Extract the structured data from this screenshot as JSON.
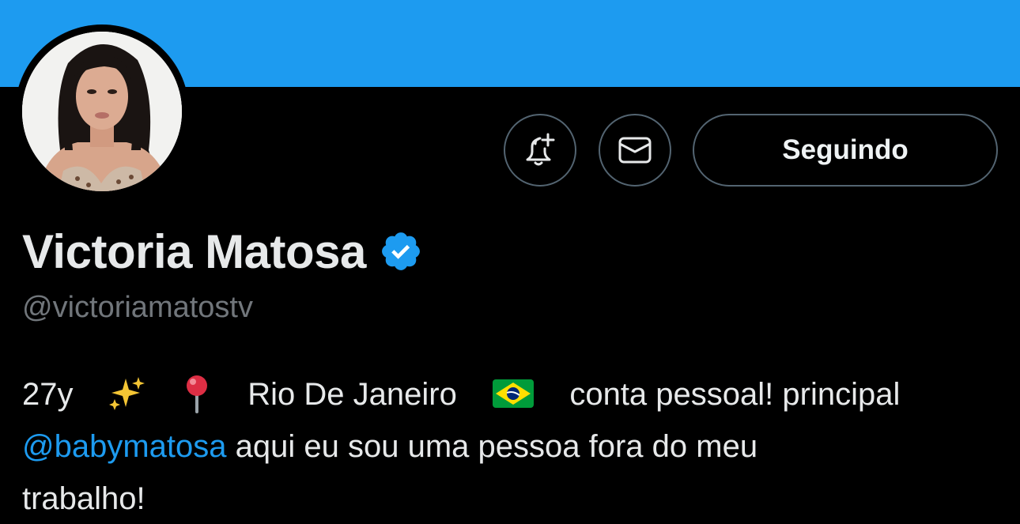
{
  "profile": {
    "banner_color": "#1d9bf0",
    "avatar_alt": "profile photo",
    "display_name": "Victoria Matosa",
    "verified_icon": "verified-badge-icon",
    "handle": "@victoriamatostv"
  },
  "actions": {
    "notify_icon": "bell-plus-icon",
    "message_icon": "envelope-icon",
    "follow_label": "Seguindo"
  },
  "bio": {
    "age": "27y",
    "sparkles_icon": "sparkles-emoji",
    "pin_icon": "round-pushpin-emoji",
    "location": "Rio De Janeiro",
    "flag_icon": "brazil-flag-emoji",
    "text_after_flag": "conta pessoal! principal",
    "mention": "@babymatosa",
    "text_after_mention": " aqui eu sou uma pessoa fora do meu",
    "last_line": "trabalho!"
  },
  "colors": {
    "accent": "#1d9bf0",
    "text": "#e7e9ea",
    "muted": "#71767b",
    "border": "#536471"
  }
}
